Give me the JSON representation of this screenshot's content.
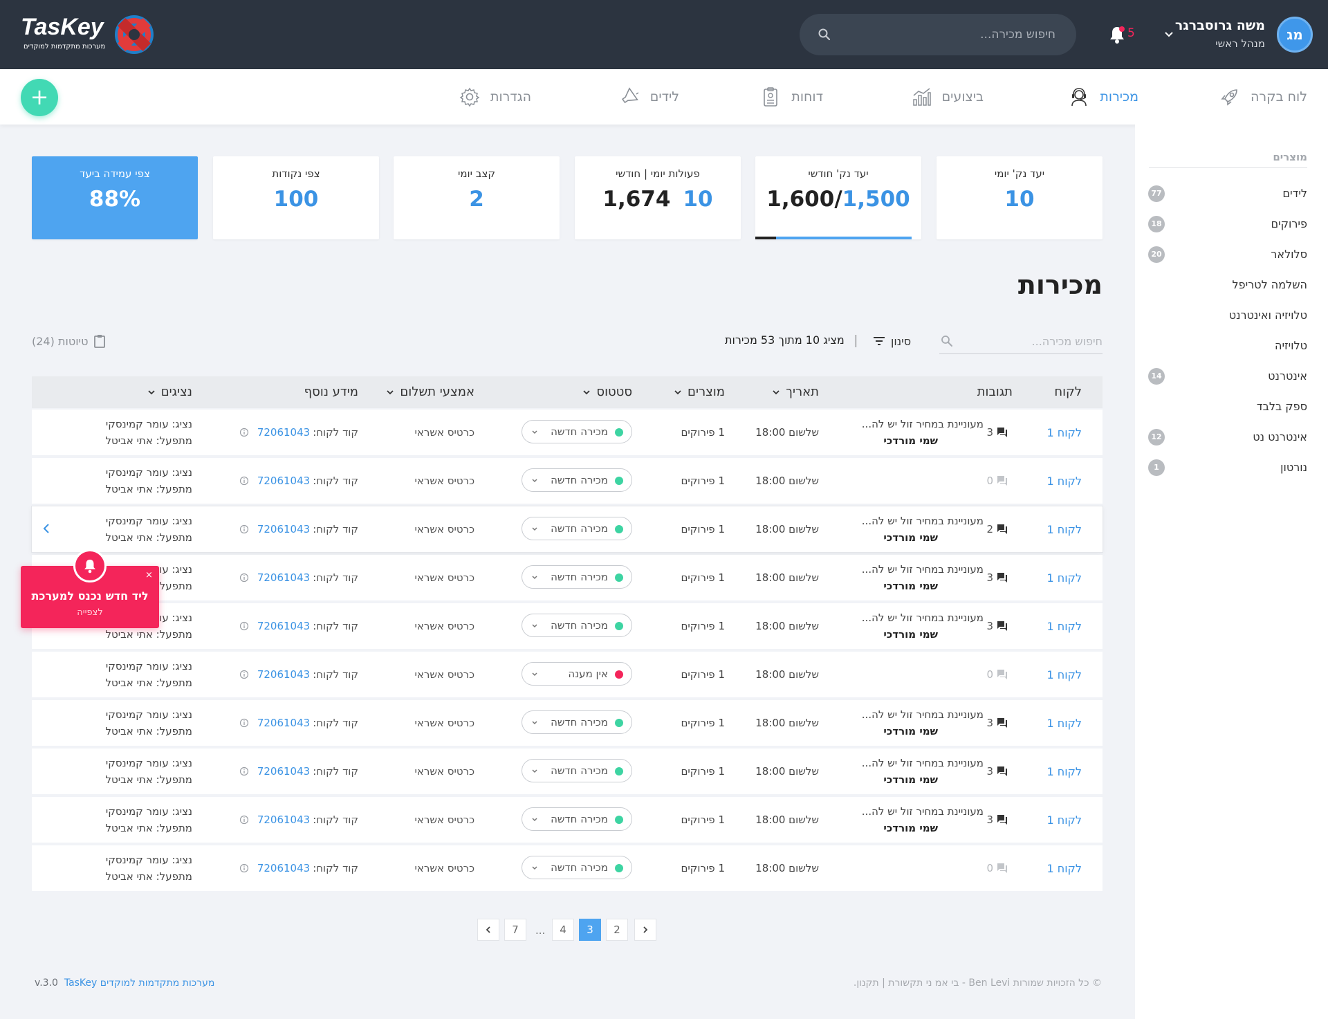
{
  "header": {
    "logo_text": "TasKey",
    "logo_subtitle": "מערכות מתקדמות למוקדים",
    "search_placeholder": "חיפוש מכירה...",
    "notification_count": "5",
    "user_name": "משה גרוסברגר",
    "user_role": "מנהל ראשי",
    "user_initials": "מג"
  },
  "nav": {
    "items": [
      {
        "label": "לוח בקרה",
        "icon": "rocket-icon"
      },
      {
        "label": "מכירות",
        "icon": "headset-agent-icon",
        "active": true
      },
      {
        "label": "ביצועים",
        "icon": "bar-chart-icon"
      },
      {
        "label": "דוחות",
        "icon": "clipboard-report-icon"
      },
      {
        "label": "לידים",
        "icon": "megaphone-icon"
      },
      {
        "label": "הגדרות",
        "icon": "gear-icon"
      }
    ],
    "add_label": "+"
  },
  "sidebar": {
    "title": "מוצרים",
    "items": [
      {
        "label": "לידים",
        "count": "77"
      },
      {
        "label": "פירוקים",
        "count": "18"
      },
      {
        "label": "סלולאר",
        "count": "20"
      },
      {
        "label": "השלמה לטריפל",
        "count": ""
      },
      {
        "label": "טלויזיה ואינטרנט",
        "count": ""
      },
      {
        "label": "טלויזיה",
        "count": ""
      },
      {
        "label": "אינטרנט",
        "count": "14"
      },
      {
        "label": "ספק בלבד",
        "count": ""
      },
      {
        "label": "אינטרנט נט",
        "count": "12"
      },
      {
        "label": "נורטון",
        "count": "1"
      }
    ]
  },
  "kpis": [
    {
      "label": "יעד נק' יומי",
      "value": "10"
    },
    {
      "label": "יעד נק' חודשי",
      "value_primary": "1,500",
      "separator": "/",
      "value_secondary": "1,600",
      "progress": 0.94
    },
    {
      "label": "פעולות יומי | חודשי",
      "value_primary": "10",
      "value_secondary": "1,674"
    },
    {
      "label": "קצב יומי",
      "value": "2"
    },
    {
      "label": "צפי נקודות",
      "value": "100"
    },
    {
      "label": "צפי עמידה ביעד",
      "value": "88%"
    }
  ],
  "main": {
    "title": "מכירות",
    "search_placeholder": "חיפוש מכירה...",
    "filter_label": "סינון",
    "showing_text": "מציג 10 מתוך 53 מכירות",
    "drafts_label": "טיוטות (24)"
  },
  "table": {
    "columns": [
      {
        "label": "לקוח"
      },
      {
        "label": "תגובות"
      },
      {
        "label": "תאריך"
      },
      {
        "label": "מוצרים"
      },
      {
        "label": "סטטוס"
      },
      {
        "label": "אמצעי תשלום"
      },
      {
        "label": "מידע נוסף"
      },
      {
        "label": "נציגים"
      }
    ],
    "rows": [
      {
        "customer": "לקוח 1",
        "responses": "3",
        "response_text": "מעוניינת במחיר זול יש לה...",
        "response_author": "שמי מורדכי",
        "date": "שלשום 18:00",
        "products": "1 פירוקים",
        "status": "מכירה חדשה",
        "status_color": "#3dd4a2",
        "payment": "כרטיס אשראי",
        "extra_label": "קוד לקוח:",
        "extra_code": "72061043",
        "agent": "נציג: עומר קמינסקי",
        "operator": "מתפעל: אתי אביטל"
      },
      {
        "customer": "לקוח 1",
        "responses": "0",
        "response_text": "",
        "response_author": "",
        "date": "שלשום 18:00",
        "products": "1 פירוקים",
        "status": "מכירה חדשה",
        "status_color": "#3dd4a2",
        "payment": "כרטיס אשראי",
        "extra_label": "קוד לקוח:",
        "extra_code": "72061043",
        "agent": "נציג: עומר קמינסקי",
        "operator": "מתפעל: אתי אביטל"
      },
      {
        "customer": "לקוח 1",
        "responses": "2",
        "response_text": "מעוניינת במחיר זול יש לה...",
        "response_author": "שמי מורדכי",
        "date": "שלשום 18:00",
        "products": "1 פירוקים",
        "status": "מכירה חדשה",
        "status_color": "#3dd4a2",
        "payment": "כרטיס אשראי",
        "extra_label": "קוד לקוח:",
        "extra_code": "72061043",
        "agent": "נציג: עומר קמינסקי",
        "operator": "מתפעל: אתי אביטל"
      },
      {
        "customer": "לקוח 1",
        "responses": "3",
        "response_text": "מעוניינת במחיר זול יש לה...",
        "response_author": "שמי מורדכי",
        "date": "שלשום 18:00",
        "products": "1 פירוקים",
        "status": "מכירה חדשה",
        "status_color": "#3dd4a2",
        "payment": "כרטיס אשראי",
        "extra_label": "קוד לקוח:",
        "extra_code": "72061043",
        "agent": "נציג: עומר קמינסקי",
        "operator": "מתפעל: אתי אביטל"
      },
      {
        "customer": "לקוח 1",
        "responses": "3",
        "response_text": "מעוניינת במחיר זול יש לה...",
        "response_author": "שמי מורדכי",
        "date": "שלשום 18:00",
        "products": "1 פירוקים",
        "status": "מכירה חדשה",
        "status_color": "#3dd4a2",
        "payment": "כרטיס אשראי",
        "extra_label": "קוד לקוח:",
        "extra_code": "72061043",
        "agent": "נציג: עומר קמינסקי",
        "operator": "מתפעל: אתי אביטל"
      },
      {
        "customer": "לקוח 1",
        "responses": "0",
        "response_text": "",
        "response_author": "",
        "date": "שלשום 18:00",
        "products": "1 פירוקים",
        "status": "אין מענה",
        "status_color": "#f4255a",
        "payment": "כרטיס אשראי",
        "extra_label": "קוד לקוח:",
        "extra_code": "72061043",
        "agent": "נציג: עומר קמינסקי",
        "operator": "מתפעל: אתי אביטל"
      },
      {
        "customer": "לקוח 1",
        "responses": "3",
        "response_text": "מעוניינת במחיר זול יש לה...",
        "response_author": "שמי מורדכי",
        "date": "שלשום 18:00",
        "products": "1 פירוקים",
        "status": "מכירה חדשה",
        "status_color": "#3dd4a2",
        "payment": "כרטיס אשראי",
        "extra_label": "קוד לקוח:",
        "extra_code": "72061043",
        "agent": "נציג: עומר קמינסקי",
        "operator": "מתפעל: אתי אביטל"
      },
      {
        "customer": "לקוח 1",
        "responses": "3",
        "response_text": "מעוניינת במחיר זול יש לה...",
        "response_author": "שמי מורדכי",
        "date": "שלשום 18:00",
        "products": "1 פירוקים",
        "status": "מכירה חדשה",
        "status_color": "#3dd4a2",
        "payment": "כרטיס אשראי",
        "extra_label": "קוד לקוח:",
        "extra_code": "72061043",
        "agent": "נציג: עומר קמינסקי",
        "operator": "מתפעל: אתי אביטל"
      },
      {
        "customer": "לקוח 1",
        "responses": "3",
        "response_text": "מעוניינת במחיר זול יש לה...",
        "response_author": "שמי מורדכי",
        "date": "שלשום 18:00",
        "products": "1 פירוקים",
        "status": "מכירה חדשה",
        "status_color": "#3dd4a2",
        "payment": "כרטיס אשראי",
        "extra_label": "קוד לקוח:",
        "extra_code": "72061043",
        "agent": "נציג: עומר קמינסקי",
        "operator": "מתפעל: אתי אביטל"
      },
      {
        "customer": "לקוח 1",
        "responses": "0",
        "response_text": "",
        "response_author": "",
        "date": "שלשום 18:00",
        "products": "1 פירוקים",
        "status": "מכירה חדשה",
        "status_color": "#3dd4a2",
        "payment": "כרטיס אשראי",
        "extra_label": "קוד לקוח:",
        "extra_code": "72061043",
        "agent": "נציג: עומר קמינסקי",
        "operator": "מתפעל: אתי אביטל"
      }
    ]
  },
  "toast": {
    "title": "ליד חדש נכנס למערכת",
    "subtitle": "לצפייה",
    "close": "×"
  },
  "pagination": {
    "pages": [
      "2",
      "3",
      "4",
      "...",
      "7"
    ],
    "active_page": "3"
  },
  "footer": {
    "copyright": "© כל הזכויות שמורות Ben Levi - בי אמ ני תקשורת | תקנון.",
    "brand": "TasKey מערכות מתקדמות למוקדים",
    "version": "v.3.0"
  },
  "colors": {
    "header_bg": "#2c3440",
    "accent_blue": "#3b93e4",
    "accent_green": "#42d9b4",
    "alert_red": "#f4255a"
  }
}
